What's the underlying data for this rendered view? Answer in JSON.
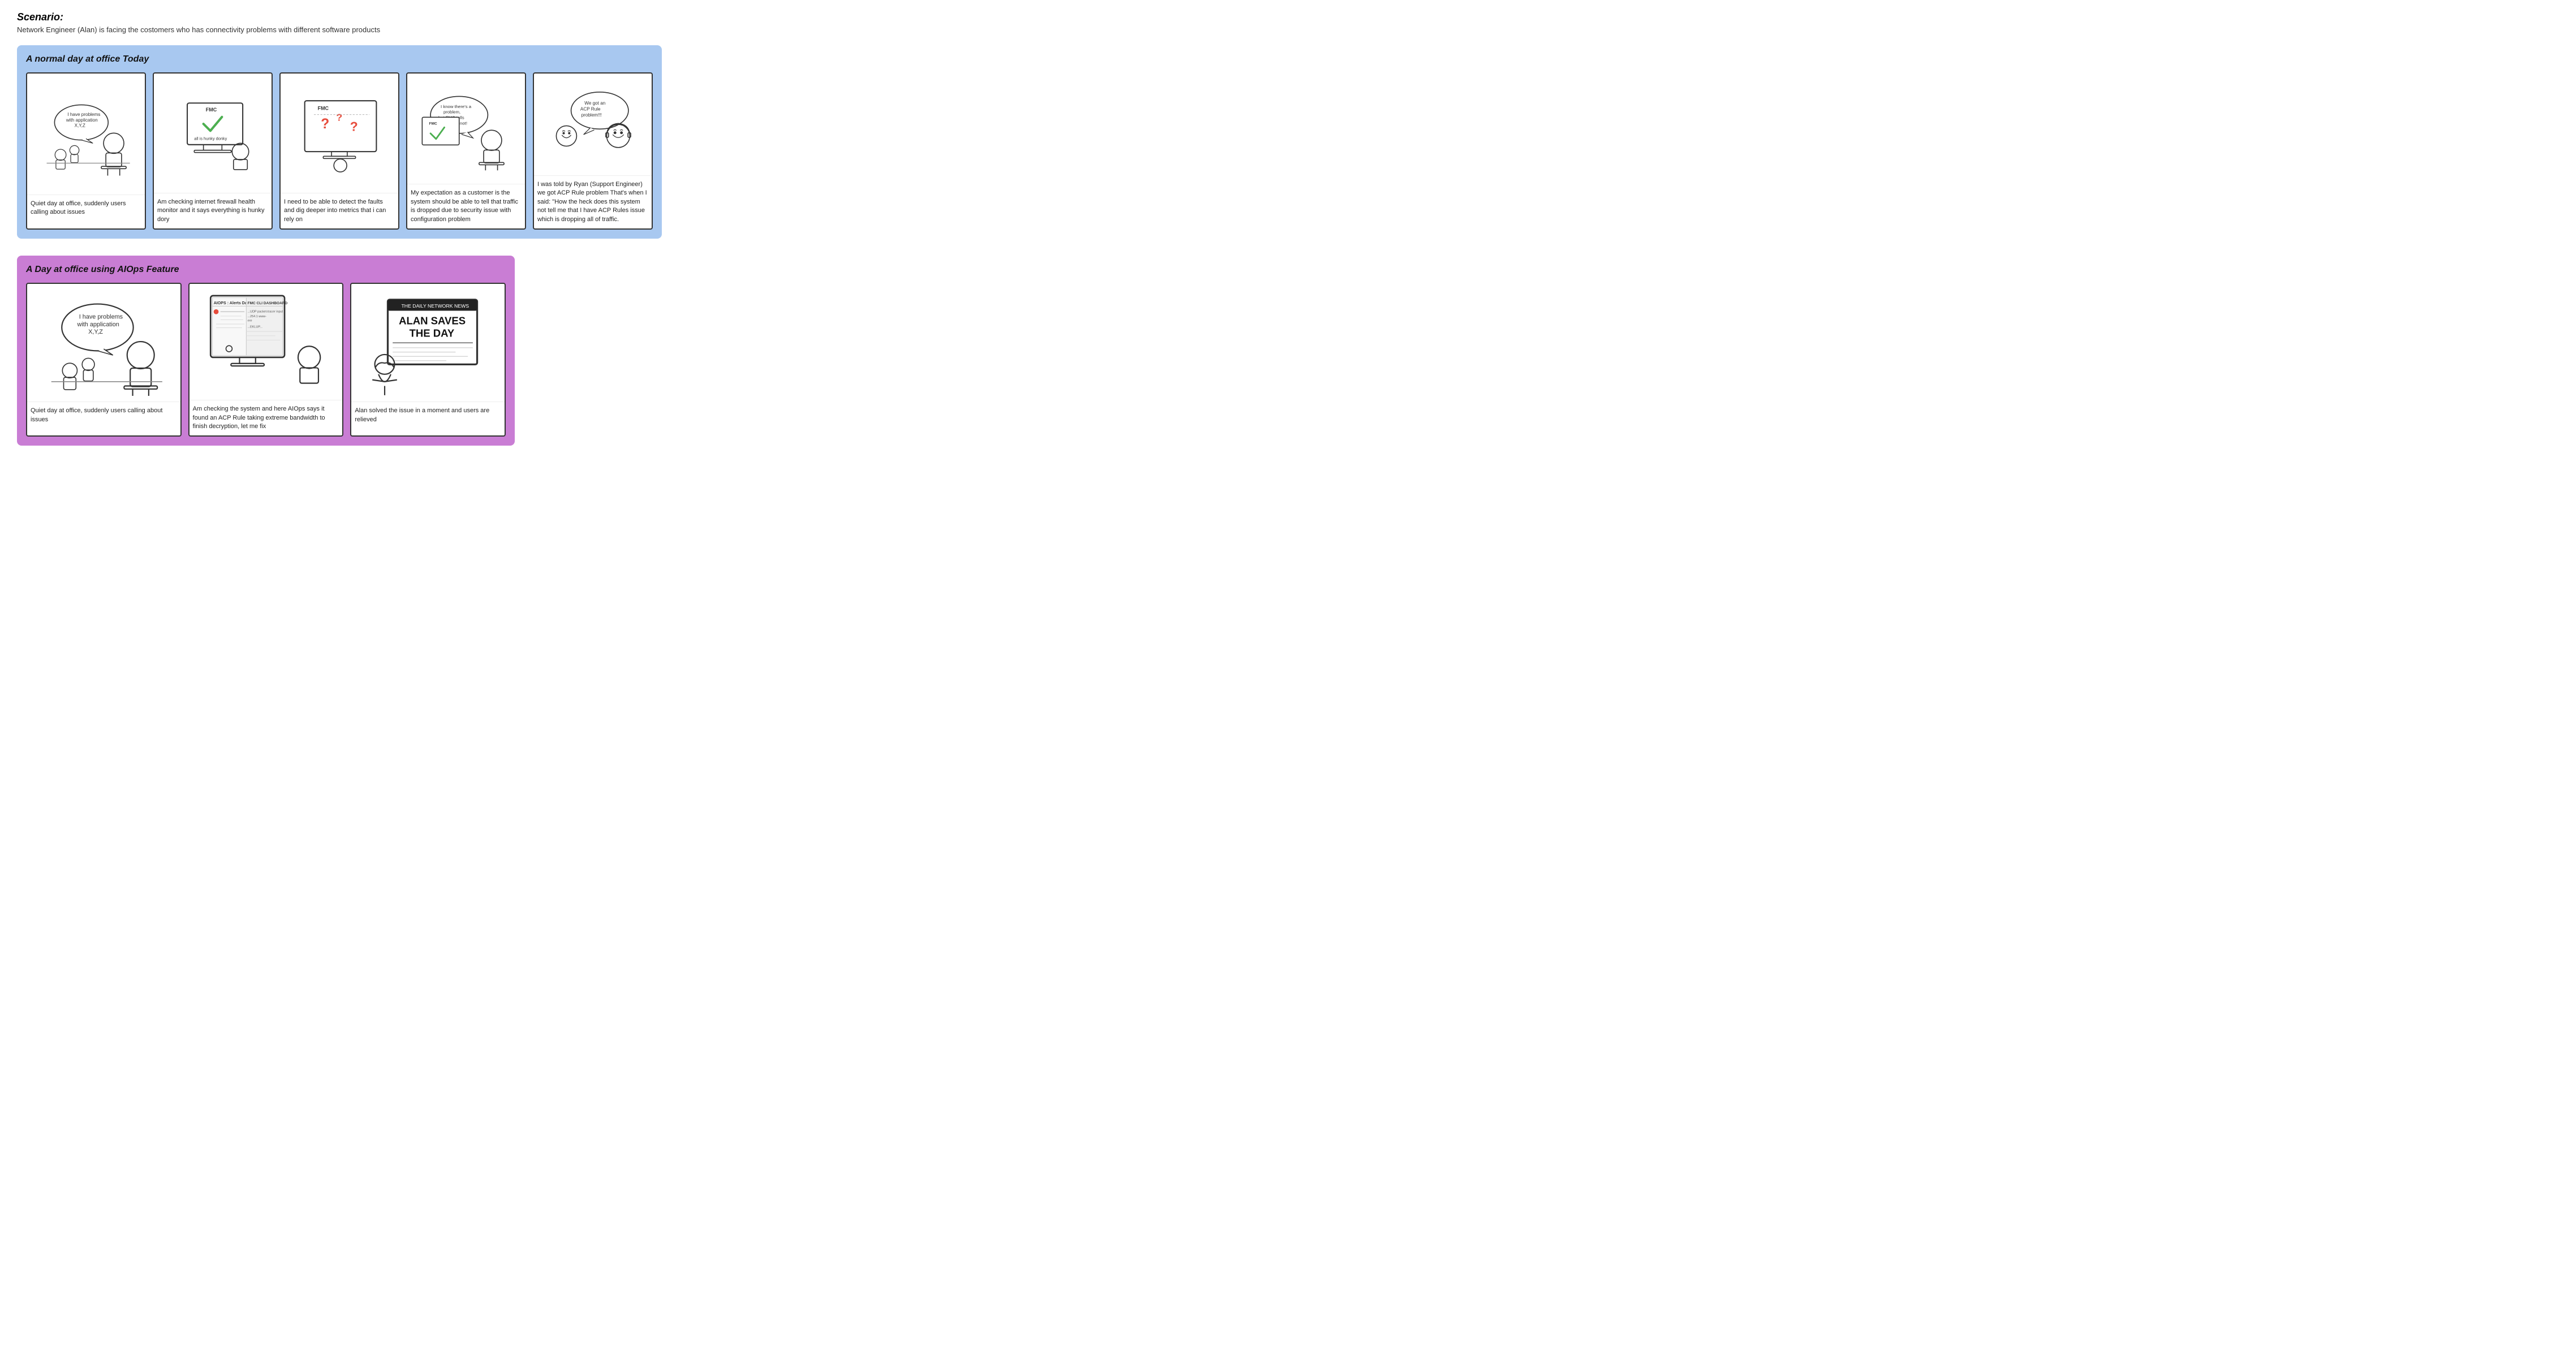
{
  "scenario": {
    "title": "Scenario:",
    "description": "Network Engineer (Alan) is facing the costomers who has connectivity problems with different software products"
  },
  "storyboard1": {
    "title": "A normal day at office Today",
    "panels": [
      {
        "id": "p1",
        "speech": "I have problems with application X,Y,Z",
        "caption": "Quiet day at office, suddenly users calling about issues"
      },
      {
        "id": "p2",
        "screen_label": "FMC",
        "screen_text": "all is hunky donky",
        "caption": "Am checking internet firewall health monitor and it says everything is hunky dory"
      },
      {
        "id": "p3",
        "caption": "I need to be able to detect the faults and dig deeper into metrics that i can rely on"
      },
      {
        "id": "p4",
        "speech": "I know there's a problem, but FMC tells me there's not!",
        "caption": "My expectation as a customer is the system should be able to tell that traffic is dropped due to security issue with configuration problem"
      },
      {
        "id": "p5",
        "speech": "We got an ACP Rule problem!!!",
        "caption": "I was told by Ryan (Support Engineer) we got ACP Rule problem\n\nThat's when I said: \"How the heck does this system not tell me that I have ACP Rules issue which is dropping all of traffic."
      }
    ]
  },
  "storyboard2": {
    "title": "A Day at office using AIOps Feature",
    "panels": [
      {
        "id": "p6",
        "speech": "I have problems with application X,Y,Z",
        "caption": "Quiet day at office, suddenly users calling about issues"
      },
      {
        "id": "p7",
        "caption": "Am checking the system and here AIOps says it found an ACP Rule taking extreme bandwidth to finish decryption, let me fix"
      },
      {
        "id": "p8",
        "headline": "ALAN SAVES THE DAY",
        "caption": "Alan solved the issue in a moment and users are relieved"
      }
    ]
  }
}
